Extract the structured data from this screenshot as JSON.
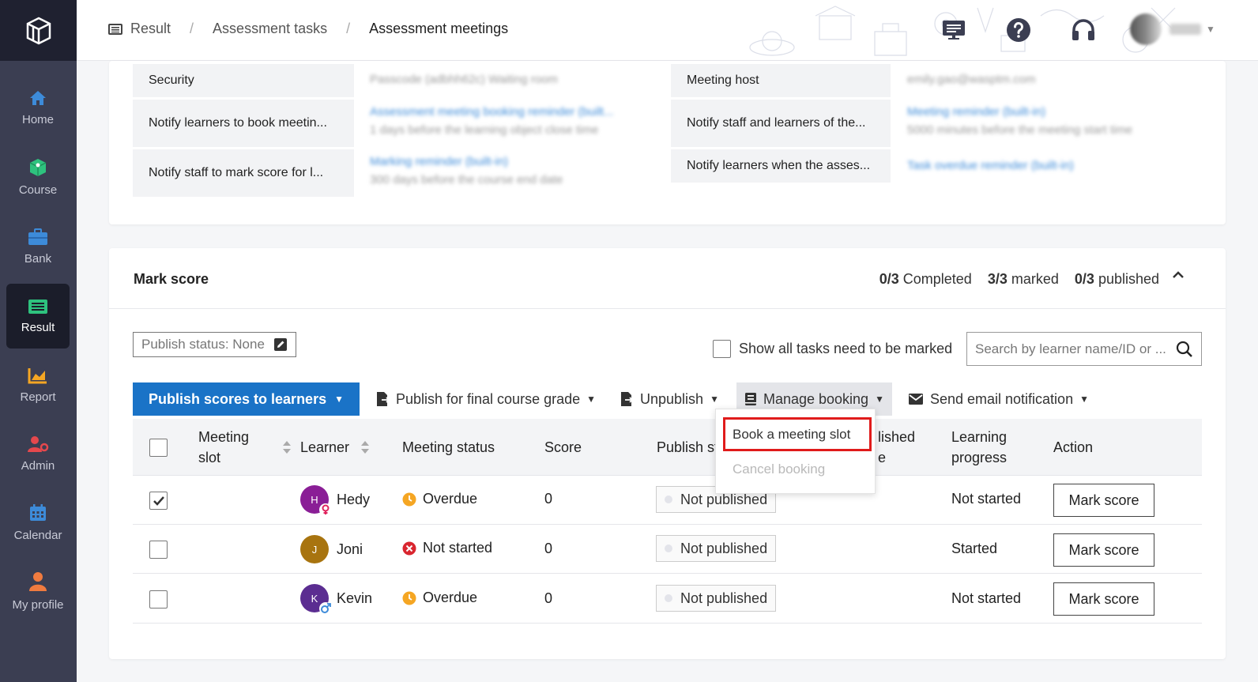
{
  "nav": {
    "items": [
      {
        "label": "Home",
        "icon": "home-icon",
        "color": "#3d8bd9"
      },
      {
        "label": "Course",
        "icon": "cube-icon",
        "color": "#2ec27e"
      },
      {
        "label": "Bank",
        "icon": "briefcase-icon",
        "color": "#3d8bd9"
      },
      {
        "label": "Result",
        "icon": "result-icon",
        "color": "#2ec27e",
        "active": true
      },
      {
        "label": "Report",
        "icon": "chart-icon",
        "color": "#f5a623"
      },
      {
        "label": "Admin",
        "icon": "admin-icon",
        "color": "#e5484d"
      },
      {
        "label": "Calendar",
        "icon": "calendar-icon",
        "color": "#3d8bd9"
      },
      {
        "label": "My profile",
        "icon": "person-icon",
        "color": "#f07b3f"
      }
    ]
  },
  "breadcrumb": {
    "result": "Result",
    "tasks": "Assessment tasks",
    "meetings": "Assessment meetings"
  },
  "settings": {
    "security_label": "Security",
    "security_value": "Passcode (adbhh62c) Waiting room",
    "meeting_host_label": "Meeting host",
    "meeting_host_value": "emily.gao@wasptm.com",
    "notify_book_label": "Notify learners to book meetin...",
    "notify_book_link": "Assessment meeting booking reminder (built...",
    "notify_book_text": "1 days before the learning object close time",
    "notify_staff_label": "Notify staff and learners of the...",
    "notify_staff_link": "Meeting reminder (built-in)",
    "notify_staff_text": "5000 minutes before the meeting start time",
    "notify_mark_label": "Notify staff to mark score for l...",
    "notify_mark_link": "Marking reminder (built-in)",
    "notify_mark_text": "300 days before the course end date",
    "notify_asses_label": "Notify learners when the asses...",
    "notify_asses_link": "Task overdue reminder (built-in)"
  },
  "mark_score": {
    "title": "Mark score",
    "completed_count": "0/3",
    "completed_label": "Completed",
    "marked_count": "3/3",
    "marked_label": "marked",
    "published_count": "0/3",
    "published_label": "published",
    "publish_status_filter": "Publish status: None",
    "show_all_label": "Show all tasks need to be marked",
    "search_placeholder": "Search by learner name/ID or ...",
    "toolbar": {
      "publish_scores": "Publish scores to learners",
      "publish_final": "Publish for final course grade",
      "unpublish": "Unpublish",
      "manage_booking": "Manage booking",
      "send_email": "Send email notification"
    },
    "dropdown": {
      "book": "Book a meeting slot",
      "cancel": "Cancel booking"
    },
    "columns": {
      "meeting_slot_1": "Meeting",
      "meeting_slot_2": "slot",
      "learner": "Learner",
      "meeting_status": "Meeting status",
      "score": "Score",
      "publish_status": "Publish st",
      "published_1": "lished",
      "published_2": "e",
      "progress_1": "Learning",
      "progress_2": "progress",
      "action": "Action"
    },
    "rows": [
      {
        "checked": true,
        "initial": "H",
        "avatar_color": "#8a1e96",
        "badge": "female",
        "name": "Hedy",
        "status": "Overdue",
        "status_icon": "clock-icon",
        "score": "0",
        "publish": "Not published",
        "progress": "Not started",
        "action": "Mark score"
      },
      {
        "checked": false,
        "initial": "J",
        "avatar_color": "#a8740f",
        "badge": "",
        "name": "Joni",
        "status": "Not started",
        "status_icon": "error-icon",
        "score": "0",
        "publish": "Not published",
        "progress": "Started",
        "action": "Mark score"
      },
      {
        "checked": false,
        "initial": "K",
        "avatar_color": "#5b2d91",
        "badge": "male",
        "name": "Kevin",
        "status": "Overdue",
        "status_icon": "clock-icon",
        "score": "0",
        "publish": "Not published",
        "progress": "Not started",
        "action": "Mark score"
      }
    ]
  }
}
